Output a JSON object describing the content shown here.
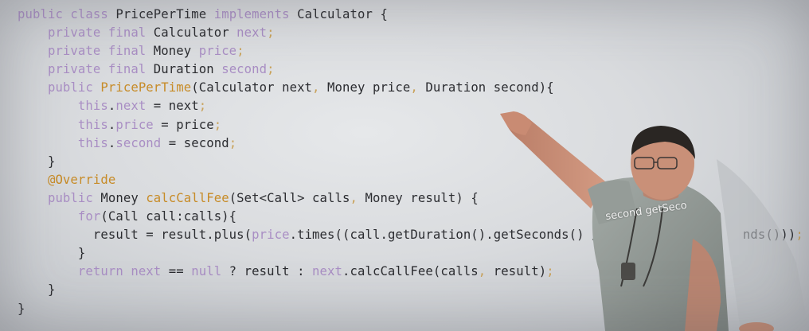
{
  "code_lines": [
    [
      {
        "t": "public class ",
        "k": "keyword"
      },
      {
        "t": "PricePerTime ",
        "k": "plain"
      },
      {
        "t": "implements ",
        "k": "keyword"
      },
      {
        "t": "Calculator {",
        "k": "plain"
      }
    ],
    [
      {
        "t": "    private final ",
        "k": "keyword"
      },
      {
        "t": "Calculator ",
        "k": "plain"
      },
      {
        "t": "next",
        "k": "field"
      },
      {
        "t": ";",
        "k": "punct"
      }
    ],
    [
      {
        "t": "    private final ",
        "k": "keyword"
      },
      {
        "t": "Money ",
        "k": "plain"
      },
      {
        "t": "price",
        "k": "field"
      },
      {
        "t": ";",
        "k": "punct"
      }
    ],
    [
      {
        "t": "    private final ",
        "k": "keyword"
      },
      {
        "t": "Duration ",
        "k": "plain"
      },
      {
        "t": "second",
        "k": "field"
      },
      {
        "t": ";",
        "k": "punct"
      }
    ],
    [
      {
        "t": "    public ",
        "k": "keyword"
      },
      {
        "t": "PricePerTime",
        "k": "method"
      },
      {
        "t": "(Calculator next",
        "k": "plain"
      },
      {
        "t": ", ",
        "k": "punct"
      },
      {
        "t": "Money price",
        "k": "plain"
      },
      {
        "t": ", ",
        "k": "punct"
      },
      {
        "t": "Duration second){",
        "k": "plain"
      }
    ],
    [
      {
        "t": "        this",
        "k": "keyword"
      },
      {
        "t": ".",
        "k": "plain"
      },
      {
        "t": "next",
        "k": "field"
      },
      {
        "t": " = next",
        "k": "plain"
      },
      {
        "t": ";",
        "k": "punct"
      }
    ],
    [
      {
        "t": "        this",
        "k": "keyword"
      },
      {
        "t": ".",
        "k": "plain"
      },
      {
        "t": "price",
        "k": "field"
      },
      {
        "t": " = price",
        "k": "plain"
      },
      {
        "t": ";",
        "k": "punct"
      }
    ],
    [
      {
        "t": "        this",
        "k": "keyword"
      },
      {
        "t": ".",
        "k": "plain"
      },
      {
        "t": "second",
        "k": "field"
      },
      {
        "t": " = second",
        "k": "plain"
      },
      {
        "t": ";",
        "k": "punct"
      }
    ],
    [
      {
        "t": "    }",
        "k": "plain"
      }
    ],
    [
      {
        "t": "    @Override",
        "k": "annotation"
      }
    ],
    [
      {
        "t": "    public ",
        "k": "keyword"
      },
      {
        "t": "Money ",
        "k": "plain"
      },
      {
        "t": "calcCallFee",
        "k": "method"
      },
      {
        "t": "(Set<Call> calls",
        "k": "plain"
      },
      {
        "t": ", ",
        "k": "punct"
      },
      {
        "t": "Money result) {",
        "k": "plain"
      }
    ],
    [
      {
        "t": "        for",
        "k": "keyword"
      },
      {
        "t": "(Call call:calls){",
        "k": "plain"
      }
    ],
    [
      {
        "t": "          result = result.plus(",
        "k": "plain"
      },
      {
        "t": "price",
        "k": "field"
      },
      {
        "t": ".times((call.getDuration().getSeconds() ",
        "k": "plain"
      },
      {
        "t": "/",
        "k": "plain"
      },
      {
        "t": "                   nds()))",
        "k": "plain"
      },
      {
        "t": ";",
        "k": "punct"
      }
    ],
    [
      {
        "t": "        }",
        "k": "plain"
      }
    ],
    [
      {
        "t": "        return ",
        "k": "keyword"
      },
      {
        "t": "next",
        "k": "field"
      },
      {
        "t": " == ",
        "k": "plain"
      },
      {
        "t": "null",
        "k": "keyword"
      },
      {
        "t": " ? result : ",
        "k": "plain"
      },
      {
        "t": "next",
        "k": "field"
      },
      {
        "t": ".calcCallFee(calls",
        "k": "plain"
      },
      {
        "t": ", ",
        "k": "punct"
      },
      {
        "t": "result)",
        "k": "plain"
      },
      {
        "t": ";",
        "k": "punct"
      }
    ],
    [
      {
        "t": "    }",
        "k": "plain"
      }
    ],
    [
      {
        "t": "}",
        "k": "plain"
      }
    ]
  ],
  "overlay": {
    "text": "second getSeco"
  },
  "colors": {
    "keyword": "#a98ec4",
    "method": "#c78b27",
    "text": "#2b2c30",
    "wall": "#dadcdf",
    "shirt": "#8d9490",
    "skin": "#c99078"
  }
}
